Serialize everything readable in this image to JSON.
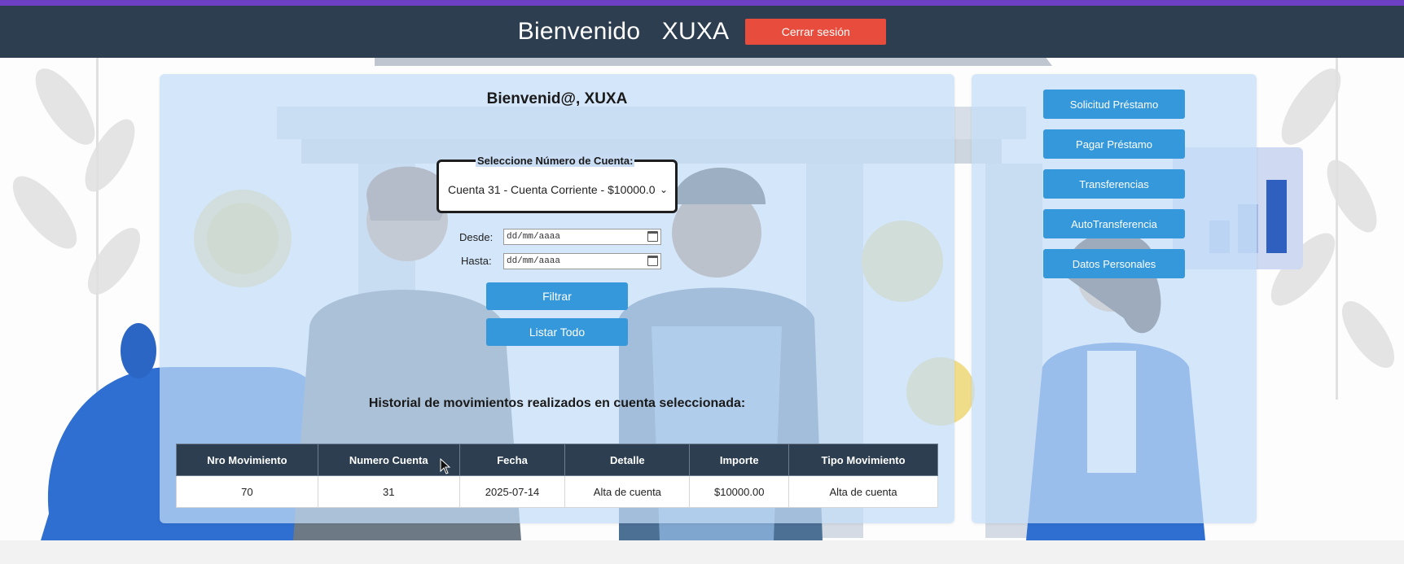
{
  "header": {
    "greeting": "Bienvenido",
    "username": "XUXA",
    "logout_label": "Cerrar sesión",
    "colors": {
      "stripe": "#6d3fc2",
      "bar": "#2c3e50",
      "logout": "#e74c3c"
    }
  },
  "main": {
    "title": "Bienvenid@, XUXA",
    "account_legend": "Seleccione Número de Cuenta:",
    "account_selected": "Cuenta 31 - Cuenta Corriente - $10000.0",
    "from_label": "Desde:",
    "from_placeholder": "dd/mm/aaaa",
    "to_label": "Hasta:",
    "to_placeholder": "dd/mm/aaaa",
    "filter_label": "Filtrar",
    "list_all_label": "Listar Todo",
    "history_title": "Historial de movimientos realizados en cuenta seleccionada:"
  },
  "table": {
    "headers": [
      "Nro Movimiento",
      "Numero Cuenta",
      "Fecha",
      "Detalle",
      "Importe",
      "Tipo Movimiento"
    ],
    "rows": [
      [
        "70",
        "31",
        "2025-07-14",
        "Alta de cuenta",
        "$10000.00",
        "Alta de cuenta"
      ]
    ]
  },
  "sidebar": {
    "items": [
      {
        "label": "Solicitud Préstamo"
      },
      {
        "label": "Pagar Préstamo"
      },
      {
        "label": "Transferencias"
      },
      {
        "label": "AutoTransferencia"
      },
      {
        "label": "Datos Personales"
      }
    ],
    "button_color": "#3498db"
  }
}
